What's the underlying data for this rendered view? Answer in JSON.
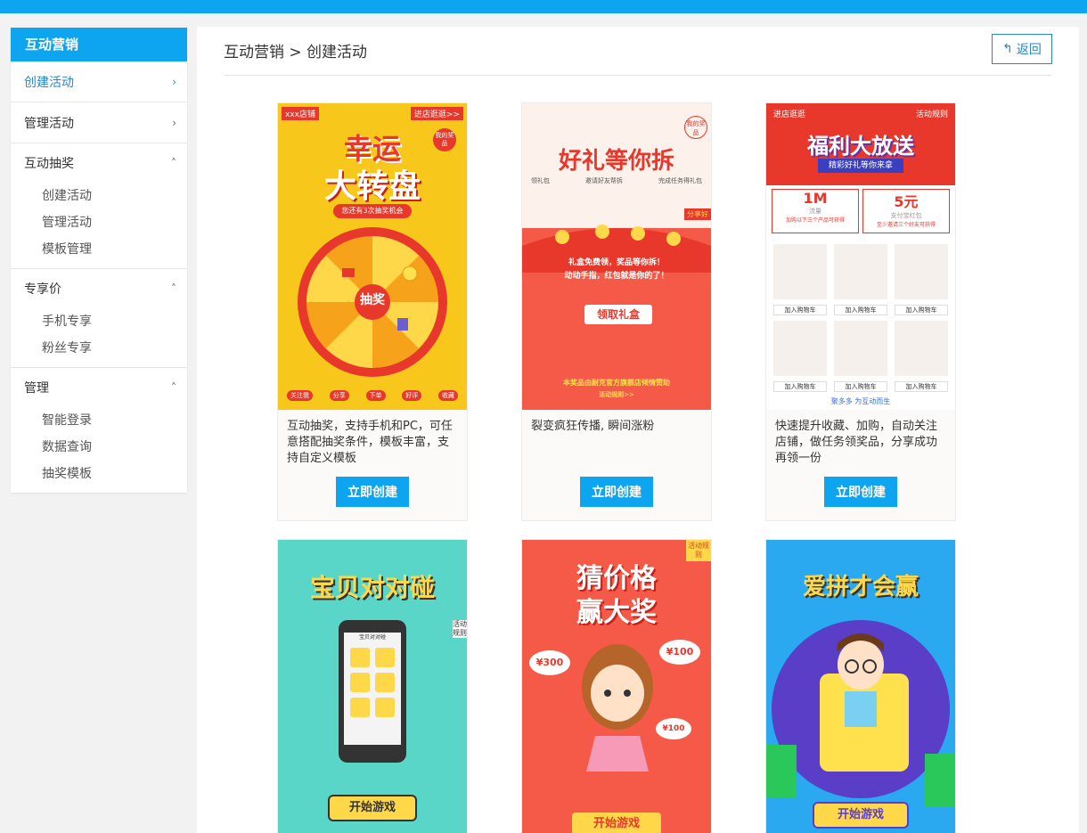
{
  "sidebar": {
    "title": "互动营销",
    "items": [
      {
        "label": "创建活动"
      },
      {
        "label": "管理活动"
      }
    ],
    "groups": [
      {
        "label": "互动抽奖",
        "subs": [
          "创建活动",
          "管理活动",
          "模板管理"
        ]
      },
      {
        "label": "专享价",
        "subs": [
          "手机专享",
          "粉丝专享"
        ]
      },
      {
        "label": "管理",
        "subs": [
          "智能登录",
          "数据查询",
          "抽奖模板"
        ]
      }
    ]
  },
  "header": {
    "breadcrumb": "互动营销 > 创建活动",
    "back_label": "返回"
  },
  "cards": [
    {
      "poster": {
        "title1": "幸运",
        "title2": "大转盘",
        "tag_left": "xxx店铺",
        "tag_right": "进店逛逛>>",
        "badge": "我的奖品",
        "chances": "您还有3次抽奖机会",
        "center": "抽奖",
        "bottom": [
          "关注我",
          "分享",
          "下单",
          "好评",
          "收藏"
        ]
      },
      "desc": "互动抽奖，支持手机和PC，可任意搭配抽奖条件，模板丰富，支持自定义模板",
      "button": "立即创建"
    },
    {
      "poster": {
        "title": "好礼等你拆",
        "badge": "我的奖品",
        "steps": [
          "领礼包",
          "邀请好友帮拆",
          "完成任务得礼包"
        ],
        "share": "分享好",
        "line1": "礼盒免费领，奖品等你拆！",
        "line2": "动动手指，红包就是你的了！",
        "cta": "领取礼盒",
        "footer": "本奖品由耐克官方旗舰店倾情赞助",
        "rules": "活动规则>>"
      },
      "desc": "裂变疯狂传播, 瞬间涨粉",
      "button": "立即创建"
    },
    {
      "poster": {
        "title": "福利大放送",
        "subtitle": "精彩好礼等你来拿",
        "tag_left": "进店逛逛",
        "tag_right": "活动规则",
        "coupon1_value": "1M",
        "coupon1_label": "流量",
        "coupon1_desc": "加购以下三个产品可获得",
        "coupon2_value": "5元",
        "coupon2_label": "支付宝红包",
        "coupon2_desc": "至少邀请三个好友可获得",
        "add_label": "加入购物车",
        "footer": "聚多多 为互动而生"
      },
      "desc": "快速提升收藏、加购，自动关注店铺，做任务领奖品，分享成功再领一份",
      "button": "立即创建"
    },
    {
      "poster": {
        "title": "宝贝对对碰",
        "screen": "宝贝对对碰",
        "side": "活动规则",
        "cta": "开始游戏"
      }
    },
    {
      "poster": {
        "title1": "猜价格",
        "title2": "赢大奖",
        "tag": "活动规则",
        "price1": "¥300",
        "price2": "¥100",
        "price3": "¥100",
        "cta": "开始游戏"
      }
    },
    {
      "poster": {
        "title": "爱拼才会赢",
        "cta": "开始游戏"
      }
    }
  ],
  "colors": {
    "accent": "#0ea5f0",
    "link": "#2a86d0"
  }
}
